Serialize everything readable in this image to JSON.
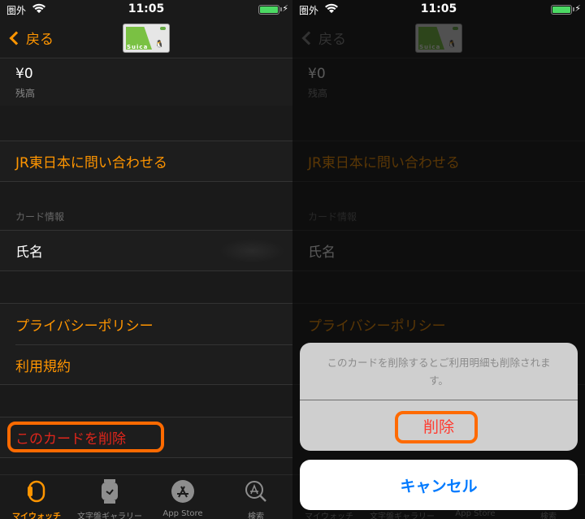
{
  "status_bar": {
    "carrier": "圏外",
    "time": "11:05",
    "battery_level": 1.0,
    "charging": true
  },
  "nav": {
    "back_label": "戻る",
    "card_brand": "Suica"
  },
  "balance": {
    "amount": "¥0",
    "label": "残高"
  },
  "links": {
    "contact": "JR東日本に問い合わせる",
    "privacy": "プライバシーポリシー",
    "terms": "利用規約"
  },
  "card_info": {
    "section_title": "カード情報",
    "name_label": "氏名"
  },
  "delete_card_label": "このカードを削除",
  "tabs": [
    {
      "label": "マイウォッチ",
      "icon": "watch-band-icon",
      "active": true
    },
    {
      "label": "文字盤ギャラリー",
      "icon": "watch-face-icon",
      "active": false
    },
    {
      "label": "App Store",
      "icon": "app-store-icon",
      "active": false
    },
    {
      "label": "検索",
      "icon": "search-icon",
      "active": false
    }
  ],
  "action_sheet": {
    "message": "このカードを削除するとご利用明細も削除されます。",
    "delete_label": "削除",
    "cancel_label": "キャンセル"
  },
  "colors": {
    "accent": "#ff9500",
    "destructive": "#e0261b",
    "highlight": "#ff6a00",
    "cancel": "#007aff",
    "battery": "#4cd964"
  }
}
